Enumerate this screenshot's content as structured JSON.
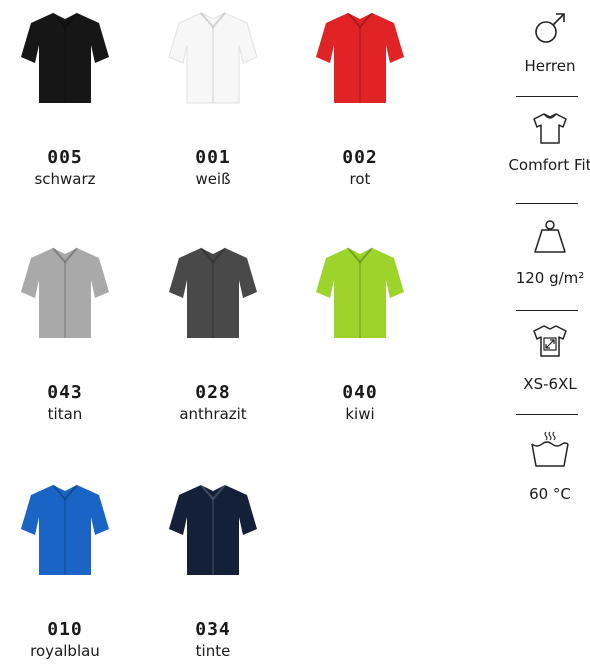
{
  "swatches": [
    {
      "code": "005",
      "name": "schwarz",
      "color": "#161616"
    },
    {
      "code": "001",
      "name": "weiß",
      "color": "#f7f7f7"
    },
    {
      "code": "002",
      "name": "rot",
      "color": "#e02325"
    },
    {
      "code": "043",
      "name": "titan",
      "color": "#a9a9a9"
    },
    {
      "code": "028",
      "name": "anthrazit",
      "color": "#494949"
    },
    {
      "code": "040",
      "name": "kiwi",
      "color": "#9cd42c"
    },
    {
      "code": "010",
      "name": "royalblau",
      "color": "#1a64c5"
    },
    {
      "code": "034",
      "name": "tinte",
      "color": "#142038"
    }
  ],
  "specs": [
    {
      "label": "Herren",
      "icon": "male-symbol-icon"
    },
    {
      "label": "Comfort Fit",
      "icon": "shirt-outline-icon"
    },
    {
      "label": "120 g/m²",
      "icon": "weight-icon"
    },
    {
      "label": "XS-6XL",
      "icon": "size-range-shirt-icon"
    },
    {
      "label": "60 °C",
      "icon": "wash-60-icon"
    }
  ]
}
